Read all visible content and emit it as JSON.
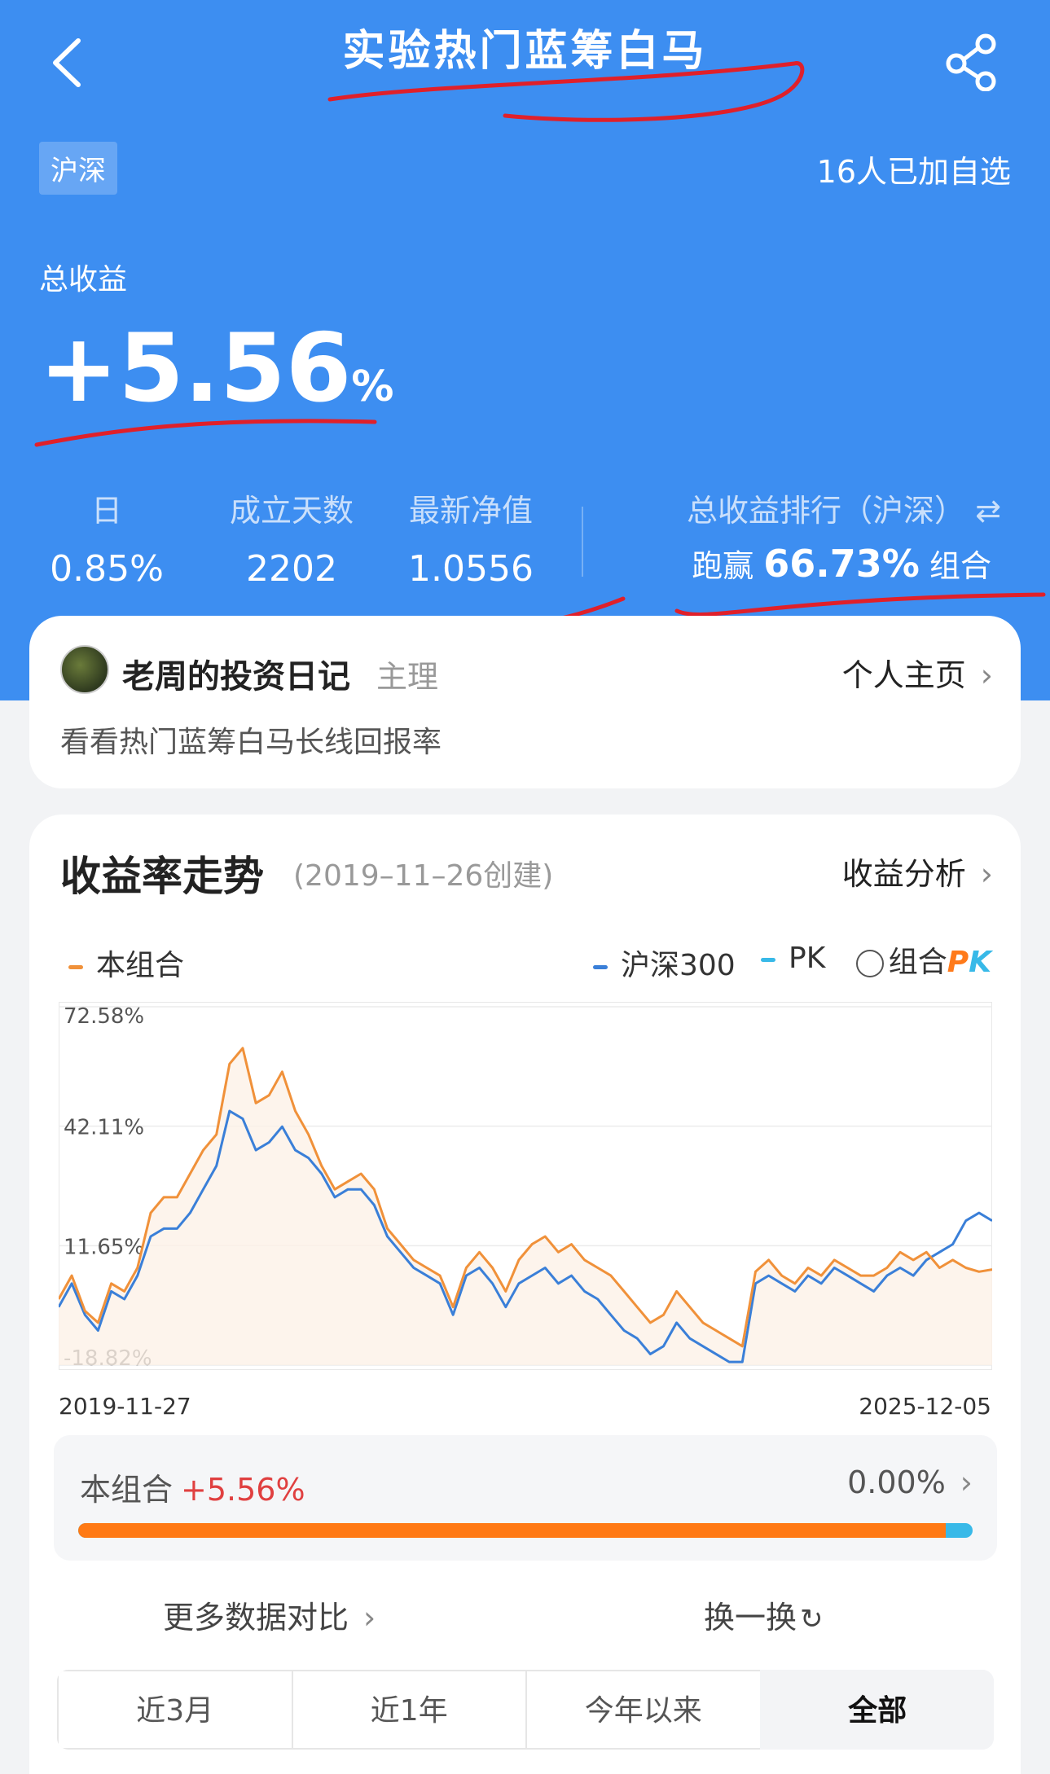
{
  "header": {
    "title": "实验热门蓝筹白马",
    "market_tag": "沪深",
    "followers": "16人已加自选"
  },
  "total": {
    "label": "总收益",
    "value": "+5.56",
    "unit": "%"
  },
  "stats": [
    {
      "label": "日",
      "value": "0.85%"
    },
    {
      "label": "成立天数",
      "value": "2202"
    },
    {
      "label": "最新净值",
      "value": "1.0556"
    }
  ],
  "rank": {
    "label": "总收益排行（沪深）",
    "prefix": "跑赢",
    "value": "66.73%",
    "suffix": "组合"
  },
  "author": {
    "name": "老周的投资日记",
    "role": "主理",
    "homepage": "个人主页",
    "description": "看看热门蓝筹白马长线回报率"
  },
  "trend": {
    "title": "收益率走势",
    "created": "(2019–11–26创建)",
    "analysis": "收益分析",
    "legend": {
      "portfolio": "本组合",
      "index": "沪深300",
      "pk": "PK",
      "pk_toggle_text": "组合",
      "pk_logo_1": "P",
      "pk_logo_2": "K"
    },
    "start_date": "2019-11-27",
    "end_date": "2025-12-05"
  },
  "compare": {
    "label": "本组合",
    "value": "+5.56%",
    "right_value": "0.00%",
    "portfolio_share": 0.97
  },
  "links": {
    "more": "更多数据对比",
    "swap": "换一换"
  },
  "tabs": [
    "近3月",
    "近1年",
    "今年以来",
    "全部"
  ],
  "colors": {
    "header_blue": "#3d8ef1",
    "portfolio": "#f0913a",
    "index": "#3a7fd8",
    "pk": "#38b9e8",
    "positive": "#e04040"
  },
  "chart_data": {
    "type": "line",
    "yticks": [
      "72.58%",
      "42.11%",
      "11.65%",
      "-18.82%"
    ],
    "ylim": [
      -18.82,
      72.58
    ],
    "x": [
      "2019-11-27",
      "2020-01",
      "2020-02",
      "2020-03",
      "2020-04",
      "2020-05",
      "2020-06",
      "2020-07",
      "2020-08",
      "2020-09",
      "2020-10",
      "2020-11",
      "2020-12",
      "2021-01",
      "2021-02",
      "2021-03",
      "2021-04",
      "2021-05",
      "2021-06",
      "2021-07",
      "2021-08",
      "2021-09",
      "2021-10",
      "2021-11",
      "2021-12",
      "2022-01",
      "2022-02",
      "2022-03",
      "2022-04",
      "2022-05",
      "2022-06",
      "2022-07",
      "2022-08",
      "2022-09",
      "2022-10",
      "2022-11",
      "2022-12",
      "2023-01",
      "2023-02",
      "2023-03",
      "2023-04",
      "2023-05",
      "2023-06",
      "2023-07",
      "2023-08",
      "2023-09",
      "2023-10",
      "2023-11",
      "2023-12",
      "2024-01",
      "2024-02",
      "2024-03",
      "2024-04",
      "2024-05",
      "2024-06",
      "2024-07",
      "2024-08",
      "2024-09",
      "2024-10",
      "2024-11",
      "2024-12",
      "2025-01",
      "2025-02",
      "2025-03",
      "2025-04",
      "2025-05",
      "2025-06",
      "2025-07",
      "2025-08",
      "2025-09",
      "2025-10",
      "2025-12-05"
    ],
    "series": [
      {
        "name": "本组合",
        "values": [
          -2,
          4,
          -5,
          -8,
          2,
          0,
          6,
          20,
          24,
          24,
          30,
          36,
          40,
          58,
          62,
          48,
          50,
          56,
          46,
          40,
          32,
          26,
          28,
          30,
          26,
          16,
          12,
          8,
          6,
          4,
          -4,
          6,
          10,
          6,
          0,
          8,
          12,
          14,
          10,
          12,
          8,
          6,
          4,
          0,
          -4,
          -8,
          -6,
          0,
          -4,
          -8,
          -10,
          -12,
          -14,
          5,
          8,
          4,
          2,
          6,
          4,
          8,
          6,
          4,
          4,
          6,
          10,
          8,
          10,
          6,
          8,
          6,
          5,
          5.56
        ]
      },
      {
        "name": "沪深300",
        "values": [
          -4,
          2,
          -6,
          -10,
          0,
          -2,
          4,
          14,
          16,
          16,
          20,
          26,
          32,
          46,
          44,
          36,
          38,
          42,
          36,
          34,
          30,
          24,
          26,
          26,
          22,
          14,
          10,
          6,
          4,
          2,
          -6,
          4,
          6,
          2,
          -4,
          2,
          4,
          6,
          2,
          4,
          0,
          -2,
          -6,
          -10,
          -12,
          -16,
          -14,
          -8,
          -12,
          -14,
          -16,
          -18,
          -18,
          2,
          4,
          2,
          0,
          4,
          2,
          6,
          4,
          2,
          0,
          4,
          6,
          4,
          8,
          10,
          12,
          18,
          20,
          18
        ]
      }
    ]
  }
}
